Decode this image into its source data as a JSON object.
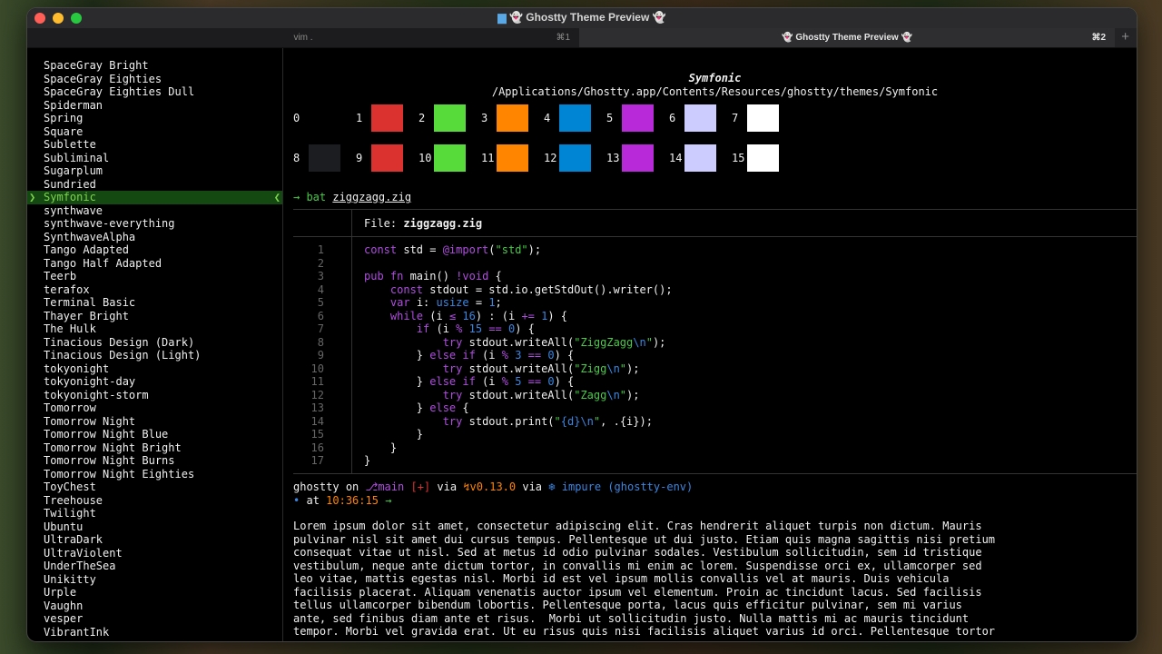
{
  "window": {
    "title": "Ghostty Theme Preview"
  },
  "tabs": [
    {
      "label": "vim .",
      "shortcut": "⌘1"
    },
    {
      "label": "Ghostty Theme Preview",
      "shortcut": "⌘2"
    }
  ],
  "new_tab_label": "+",
  "sidebar": {
    "selected": "Symfonic",
    "items": [
      "SpaceGray Bright",
      "SpaceGray Eighties",
      "SpaceGray Eighties Dull",
      "Spiderman",
      "Spring",
      "Square",
      "Sublette",
      "Subliminal",
      "Sugarplum",
      "Sundried",
      "Symfonic",
      "synthwave",
      "synthwave-everything",
      "SynthwaveAlpha",
      "Tango Adapted",
      "Tango Half Adapted",
      "Teerb",
      "terafox",
      "Terminal Basic",
      "Thayer Bright",
      "The Hulk",
      "Tinacious Design (Dark)",
      "Tinacious Design (Light)",
      "tokyonight",
      "tokyonight-day",
      "tokyonight-storm",
      "Tomorrow",
      "Tomorrow Night",
      "Tomorrow Night Blue",
      "Tomorrow Night Bright",
      "Tomorrow Night Burns",
      "Tomorrow Night Eighties",
      "ToyChest",
      "Treehouse",
      "Twilight",
      "Ubuntu",
      "UltraDark",
      "UltraViolent",
      "UnderTheSea",
      "Unikitty",
      "Urple",
      "Vaughn",
      "vesper",
      "VibrantInk"
    ]
  },
  "theme": {
    "name": "Symfonic",
    "path": "/Applications/Ghostty.app/Contents/Resources/ghostty/themes/Symfonic"
  },
  "palette": [
    {
      "index": "0",
      "color": "#000000"
    },
    {
      "index": "1",
      "color": "#dc322f"
    },
    {
      "index": "2",
      "color": "#56db3a"
    },
    {
      "index": "3",
      "color": "#ff8400"
    },
    {
      "index": "4",
      "color": "#0084d4"
    },
    {
      "index": "5",
      "color": "#b729d9"
    },
    {
      "index": "6",
      "color": "#ccccff"
    },
    {
      "index": "7",
      "color": "#ffffff"
    },
    {
      "index": "8",
      "color": "#1b1d21"
    },
    {
      "index": "9",
      "color": "#dc322f"
    },
    {
      "index": "10",
      "color": "#56db3a"
    },
    {
      "index": "11",
      "color": "#ff8400"
    },
    {
      "index": "12",
      "color": "#0084d4"
    },
    {
      "index": "13",
      "color": "#b729d9"
    },
    {
      "index": "14",
      "color": "#ccccff"
    },
    {
      "index": "15",
      "color": "#ffffff"
    }
  ],
  "command": {
    "prompt": "→ bat",
    "file": "ziggzagg.zig"
  },
  "bat": {
    "file_label": "File:",
    "file_name": "ziggzagg.zig"
  },
  "code_lines": [
    "1",
    "2",
    "3",
    "4",
    "5",
    "6",
    "7",
    "8",
    "9",
    "10",
    "11",
    "12",
    "13",
    "14",
    "15",
    "16",
    "17"
  ],
  "prompt": {
    "user": "ghostty",
    "on": "on",
    "branch": "main",
    "status": "[+]",
    "via1": "via",
    "zig_version": "v0.13.0",
    "via2": "via",
    "env": "impure (ghostty-env)",
    "at": "at",
    "time": "10:36:15"
  },
  "lorem": [
    "Lorem ipsum dolor sit amet, consectetur adipiscing elit. Cras hendrerit aliquet turpis non dictum. Mauris",
    "pulvinar nisl sit amet dui cursus tempus. Pellentesque ut dui justo. Etiam quis magna sagittis nisi pretium",
    "consequat vitae ut nisl. Sed at metus id odio pulvinar sodales. Vestibulum sollicitudin, sem id tristique",
    "vestibulum, neque ante dictum tortor, in convallis mi enim ac lorem. Suspendisse orci ex, ullamcorper sed",
    "leo vitae, mattis egestas nisl. Morbi id est vel ipsum mollis convallis vel at mauris. Duis vehicula",
    "facilisis placerat. Aliquam venenatis auctor ipsum vel elementum. Proin ac tincidunt lacus. Sed facilisis",
    "tellus ullamcorper bibendum lobortis. Pellentesque porta, lacus quis efficitur pulvinar, sem mi varius",
    "ante, sed finibus diam ante et risus.  Morbi ut sollicitudin justo. Nulla mattis mi ac mauris tincidunt",
    "tempor. Morbi vel gravida erat. Ut eu risus quis nisi facilisis aliquet varius id orci. Pellentesque tortor"
  ],
  "colors": {
    "keyword": "#b04ce0",
    "string": "#4bc94a",
    "number": "#3b86e0",
    "selection_bg": "#144a12",
    "selection_fg": "#7ed34f"
  }
}
